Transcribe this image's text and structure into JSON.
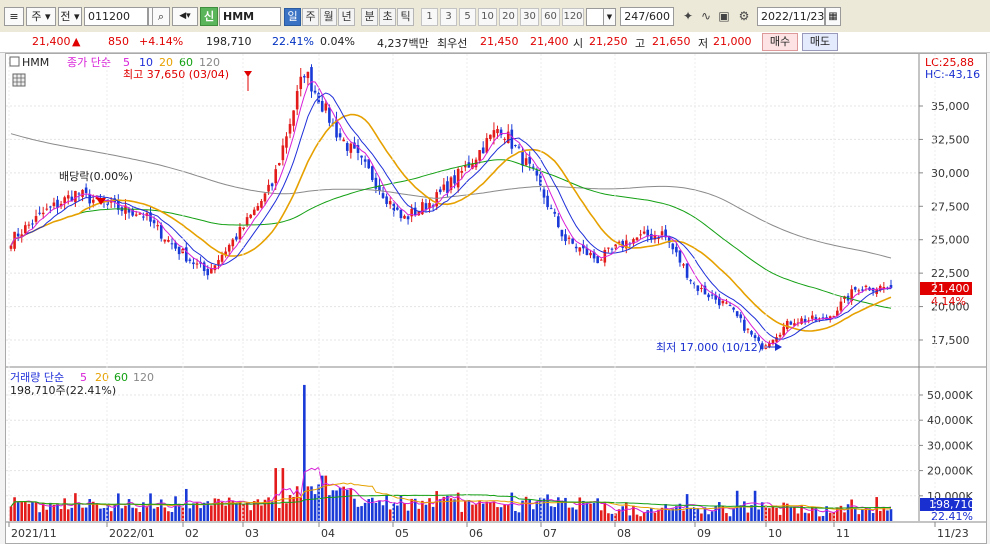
{
  "toolbar": {
    "market": "주",
    "board": "전",
    "code": "011200",
    "badge": "신",
    "name": "HMM",
    "periods": [
      "일",
      "주",
      "월",
      "년",
      "분",
      "초",
      "틱"
    ],
    "selected_period": "일",
    "intervals": [
      "1",
      "3",
      "5",
      "10",
      "20",
      "30",
      "60",
      "120"
    ],
    "count": "247",
    "count_max": "/600",
    "date": "2022/11/23"
  },
  "quote": {
    "price": "21,400",
    "arrow": "▲",
    "change": "850",
    "change_pct": "+4.14%",
    "volume": "198,710",
    "turnover": "22.41%",
    "ratio": "0.04%",
    "amount": "4,237백만",
    "best_label": "최우선",
    "best_ask": "21,450",
    "best_bid": "21,400",
    "open_label": "시",
    "open": "21,250",
    "high_label": "고",
    "high": "21,650",
    "low_label": "저",
    "low": "21,000",
    "buy_label": "매수",
    "sell_label": "매도"
  },
  "price_panel": {
    "title": "HMM",
    "legend_prefix": "종가 단순",
    "ma_periods": [
      "5",
      "10",
      "20",
      "60",
      "120"
    ],
    "ma_colors": [
      "#d81fd8",
      "#1f2fd8",
      "#e6a100",
      "#13a013",
      "#888888"
    ],
    "lc": "LC:25,88",
    "hc": "HC:-43,16",
    "y_ticks": [
      "35,000",
      "32,500",
      "30,000",
      "27,500",
      "25,000",
      "22,500",
      "20,000",
      "17,500"
    ],
    "last_price": "21,400",
    "last_pct": "4.14%",
    "high_annotation": "최고 37,650 (03/04)",
    "low_annotation": "최저 17,000 (10/12)",
    "dividend_annotation": "배당락(0.00%)"
  },
  "volume_panel": {
    "legend_prefix": "거래량 단순",
    "ma_periods": [
      "5",
      "20",
      "60",
      "120"
    ],
    "ma_colors": [
      "#d81fd8",
      "#e6a100",
      "#13a013",
      "#888888"
    ],
    "info": "198,710주(22.41%)",
    "y_ticks": [
      "50,000K",
      "40,000K",
      "30,000K",
      "20,000K",
      "10,000K"
    ],
    "last_volume": "198,710",
    "last_pct": "22.41%"
  },
  "x_axis": [
    "2021/11",
    "2022/01",
    "02",
    "03",
    "04",
    "05",
    "06",
    "07",
    "08",
    "09",
    "10",
    "11",
    "11/23"
  ],
  "chart_data": {
    "type": "candlestick",
    "title": "HMM",
    "y_unit": "KRW",
    "ylim": [
      16000,
      37800
    ],
    "close_points": [
      [
        "2021/11",
        25000
      ],
      [
        "2021/11 mid",
        27000
      ],
      [
        "2021/12",
        28500
      ],
      [
        "2021/12 mid",
        27500
      ],
      [
        "2022/01",
        27000
      ],
      [
        "2022/01 mid",
        24500
      ],
      [
        "2022/02",
        22500
      ],
      [
        "2022/02 mid",
        25500
      ],
      [
        "2022/02 late",
        29000
      ],
      [
        "2022/03/04",
        37650
      ],
      [
        "2022/03 mid",
        33000
      ],
      [
        "2022/04",
        30000
      ],
      [
        "2022/04 mid",
        26500
      ],
      [
        "2022/05",
        28000
      ],
      [
        "2022/05 mid",
        30500
      ],
      [
        "2022/06",
        33500
      ],
      [
        "2022/06 mid",
        30000
      ],
      [
        "2022/07",
        25000
      ],
      [
        "2022/07 mid",
        23500
      ],
      [
        "2022/08",
        25000
      ],
      [
        "2022/08 mid",
        25500
      ],
      [
        "2022/09",
        21500
      ],
      [
        "2022/09 mid",
        20000
      ],
      [
        "2022/10/12",
        17000
      ],
      [
        "2022/10 mid",
        19000
      ],
      [
        "2022/11",
        19000
      ],
      [
        "2022/11 mid",
        21500
      ],
      [
        "2022/11/23",
        21400
      ]
    ],
    "volume_peak": {
      "date": "2022/03",
      "value_k": 54000
    }
  }
}
